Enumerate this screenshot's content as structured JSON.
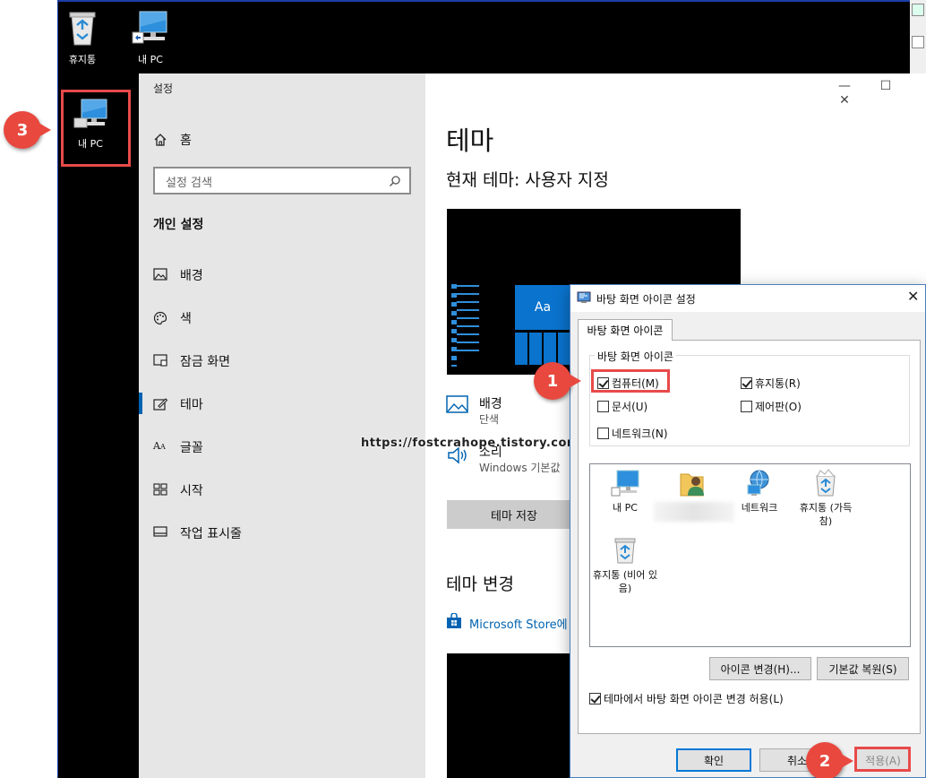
{
  "desktop": {
    "icons": [
      {
        "label": "휴지통"
      },
      {
        "label": "내 PC"
      }
    ],
    "highlighted_icon_label": "내 PC"
  },
  "settings": {
    "window_title": "설정",
    "home_label": "홈",
    "search_placeholder": "설정 검색",
    "section_title": "개인 설정",
    "nav": [
      {
        "label": "배경",
        "icon": "picture-icon"
      },
      {
        "label": "색",
        "icon": "palette-icon"
      },
      {
        "label": "잠금 화면",
        "icon": "lock-screen-icon"
      },
      {
        "label": "테마",
        "icon": "theme-brush-icon",
        "active": true
      },
      {
        "label": "글꼴",
        "icon": "font-icon"
      },
      {
        "label": "시작",
        "icon": "start-tiles-icon"
      },
      {
        "label": "작업 표시줄",
        "icon": "taskbar-icon"
      }
    ],
    "accent_color": "#0063b1"
  },
  "theme_page": {
    "title": "테마",
    "current_theme": "현재 테마: 사용자 지정",
    "preview_tile_text": "Aa",
    "background_label": "배경",
    "background_value": "단색",
    "sound_label": "소리",
    "sound_value": "Windows 기본값",
    "save_button": "테마 저장",
    "change_title": "테마 변경",
    "store_link": "Microsoft Store에"
  },
  "watermark": "https://fostcrahope.tistory.com",
  "dialog": {
    "title": "바탕 화면 아이콘 설정",
    "tab": "바탕 화면 아이콘",
    "group_label": "바탕 화면 아이콘",
    "checkboxes": [
      {
        "label": "컴퓨터(M)",
        "checked": true
      },
      {
        "label": "휴지통(R)",
        "checked": true
      },
      {
        "label": "문서(U)",
        "checked": false
      },
      {
        "label": "제어판(O)",
        "checked": false
      },
      {
        "label": "네트워크(N)",
        "checked": false
      }
    ],
    "icons": [
      {
        "label": "내 PC",
        "icon": "computer-icon"
      },
      {
        "label": "",
        "icon": "user-folder-icon"
      },
      {
        "label": "네트워크",
        "icon": "network-icon"
      },
      {
        "label": "휴지통 (가득 참)",
        "icon": "recycle-bin-full-icon"
      },
      {
        "label": "휴지통 (비어 있음)",
        "icon": "recycle-bin-empty-icon"
      }
    ],
    "change_icon_button": "아이콘 변경(H)...",
    "restore_default_button": "기본값 복원(S)",
    "allow_themes_checkbox": {
      "label": "테마에서 바탕 화면 아이콘 변경 허용(L)",
      "checked": true
    },
    "ok_button": "확인",
    "cancel_button": "취소",
    "apply_button": "적용(A)"
  },
  "annotations": [
    "1",
    "2",
    "3"
  ]
}
